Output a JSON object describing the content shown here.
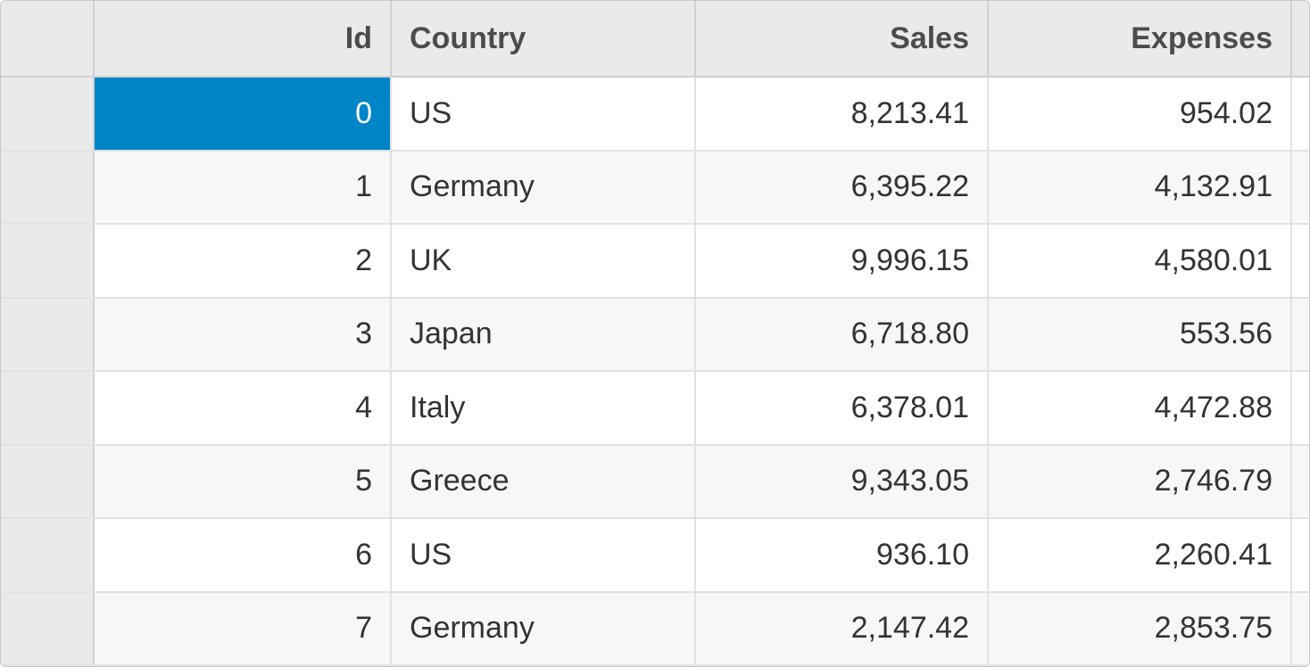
{
  "columns": {
    "id": "Id",
    "country": "Country",
    "sales": "Sales",
    "expenses": "Expenses"
  },
  "selected": {
    "row": 0,
    "col": "id"
  },
  "rows": [
    {
      "id": "0",
      "country": "US",
      "sales": "8,213.41",
      "expenses": "954.02"
    },
    {
      "id": "1",
      "country": "Germany",
      "sales": "6,395.22",
      "expenses": "4,132.91"
    },
    {
      "id": "2",
      "country": "UK",
      "sales": "9,996.15",
      "expenses": "4,580.01"
    },
    {
      "id": "3",
      "country": "Japan",
      "sales": "6,718.80",
      "expenses": "553.56"
    },
    {
      "id": "4",
      "country": "Italy",
      "sales": "6,378.01",
      "expenses": "4,472.88"
    },
    {
      "id": "5",
      "country": "Greece",
      "sales": "9,343.05",
      "expenses": "2,746.79"
    },
    {
      "id": "6",
      "country": "US",
      "sales": "936.10",
      "expenses": "2,260.41"
    },
    {
      "id": "7",
      "country": "Germany",
      "sales": "2,147.42",
      "expenses": "2,853.75"
    }
  ]
}
